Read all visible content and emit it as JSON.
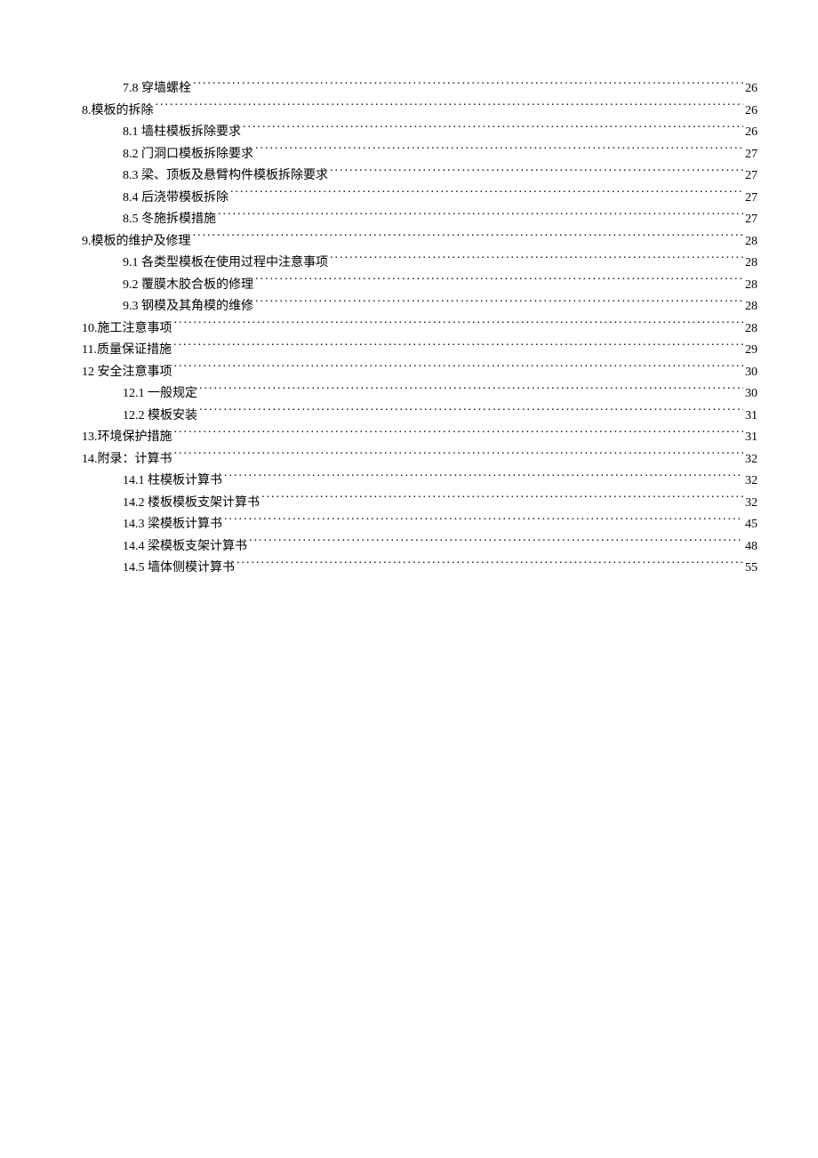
{
  "toc": [
    {
      "level": 2,
      "label": "7.8 穿墙螺栓",
      "page": "26"
    },
    {
      "level": 1,
      "label": "8.模板的拆除",
      "page": "26"
    },
    {
      "level": 2,
      "label": "8.1 墙柱模板拆除要求",
      "page": "26"
    },
    {
      "level": 2,
      "label": "8.2 门洞口模板拆除要求",
      "page": "27"
    },
    {
      "level": 2,
      "label": "8.3 梁、顶板及悬臂构件模板拆除要求",
      "page": "27"
    },
    {
      "level": 2,
      "label": "8.4 后浇带模板拆除",
      "page": "27"
    },
    {
      "level": 2,
      "label": "8.5 冬施拆模措施",
      "page": "27"
    },
    {
      "level": 1,
      "label": "9.模板的维护及修理",
      "page": "28"
    },
    {
      "level": 2,
      "label": "9.1 各类型模板在使用过程中注意事项",
      "page": "28"
    },
    {
      "level": 2,
      "label": "9.2 覆膜木胶合板的修理",
      "page": "28"
    },
    {
      "level": 2,
      "label": "9.3 钢模及其角模的维修",
      "page": "28"
    },
    {
      "level": 1,
      "label": "10.施工注意事项",
      "page": "28"
    },
    {
      "level": 1,
      "label": "11.质量保证措施",
      "page": "29"
    },
    {
      "level": 1,
      "label": "12 安全注意事项",
      "page": "30"
    },
    {
      "level": 2,
      "label": "12.1 一般规定",
      "page": "30"
    },
    {
      "level": 2,
      "label": "12.2  模板安装",
      "page": "31"
    },
    {
      "level": 1,
      "label": "13.环境保护措施",
      "page": "31"
    },
    {
      "level": 1,
      "label": "14.附录：计算书",
      "page": "32"
    },
    {
      "level": 2,
      "label": "14.1 柱模板计算书",
      "page": "32"
    },
    {
      "level": 2,
      "label": "14.2 楼板模板支架计算书",
      "page": "32"
    },
    {
      "level": 2,
      "label": "14.3 梁模板计算书",
      "page": "45"
    },
    {
      "level": 2,
      "label": "14.4 梁模板支架计算书",
      "page": "48"
    },
    {
      "level": 2,
      "label": "14.5 墙体侧模计算书",
      "page": "55"
    }
  ]
}
